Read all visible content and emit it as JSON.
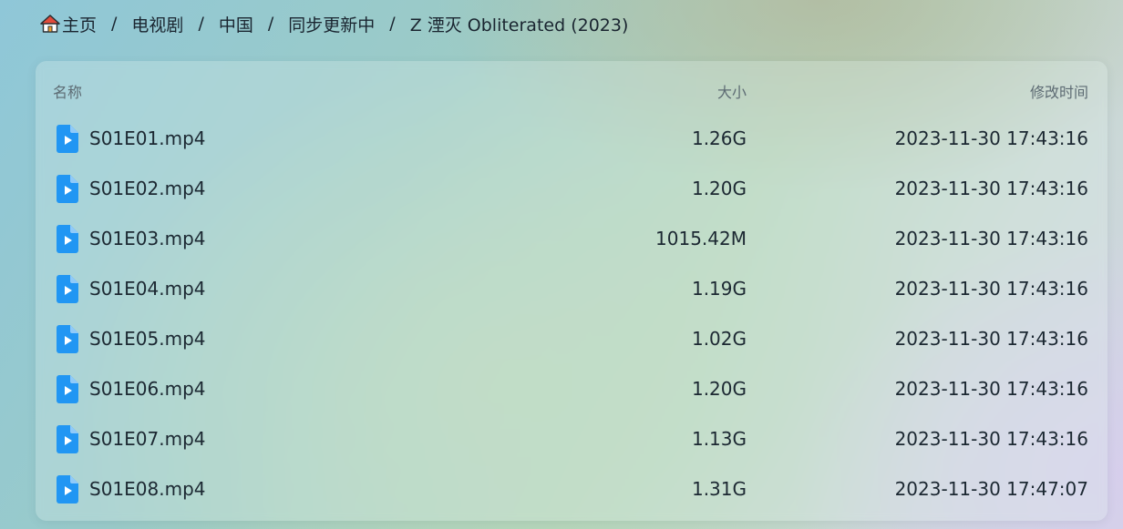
{
  "breadcrumb": {
    "home_icon": "house-icon",
    "items": [
      "主页",
      "电视剧",
      "中国",
      "同步更新中",
      "Z 湮灭 Obliterated (2023)"
    ],
    "separator": "/"
  },
  "table": {
    "headers": {
      "name": "名称",
      "size": "大小",
      "modified": "修改时间"
    },
    "file_icon": "video-file-icon",
    "file_icon_color": "#2196f3",
    "rows": [
      {
        "name": "S01E01.mp4",
        "size": "1.26G",
        "modified": "2023-11-30 17:43:16"
      },
      {
        "name": "S01E02.mp4",
        "size": "1.20G",
        "modified": "2023-11-30 17:43:16"
      },
      {
        "name": "S01E03.mp4",
        "size": "1015.42M",
        "modified": "2023-11-30 17:43:16"
      },
      {
        "name": "S01E04.mp4",
        "size": "1.19G",
        "modified": "2023-11-30 17:43:16"
      },
      {
        "name": "S01E05.mp4",
        "size": "1.02G",
        "modified": "2023-11-30 17:43:16"
      },
      {
        "name": "S01E06.mp4",
        "size": "1.20G",
        "modified": "2023-11-30 17:43:16"
      },
      {
        "name": "S01E07.mp4",
        "size": "1.13G",
        "modified": "2023-11-30 17:43:16"
      },
      {
        "name": "S01E08.mp4",
        "size": "1.31G",
        "modified": "2023-11-30 17:47:07"
      }
    ]
  }
}
